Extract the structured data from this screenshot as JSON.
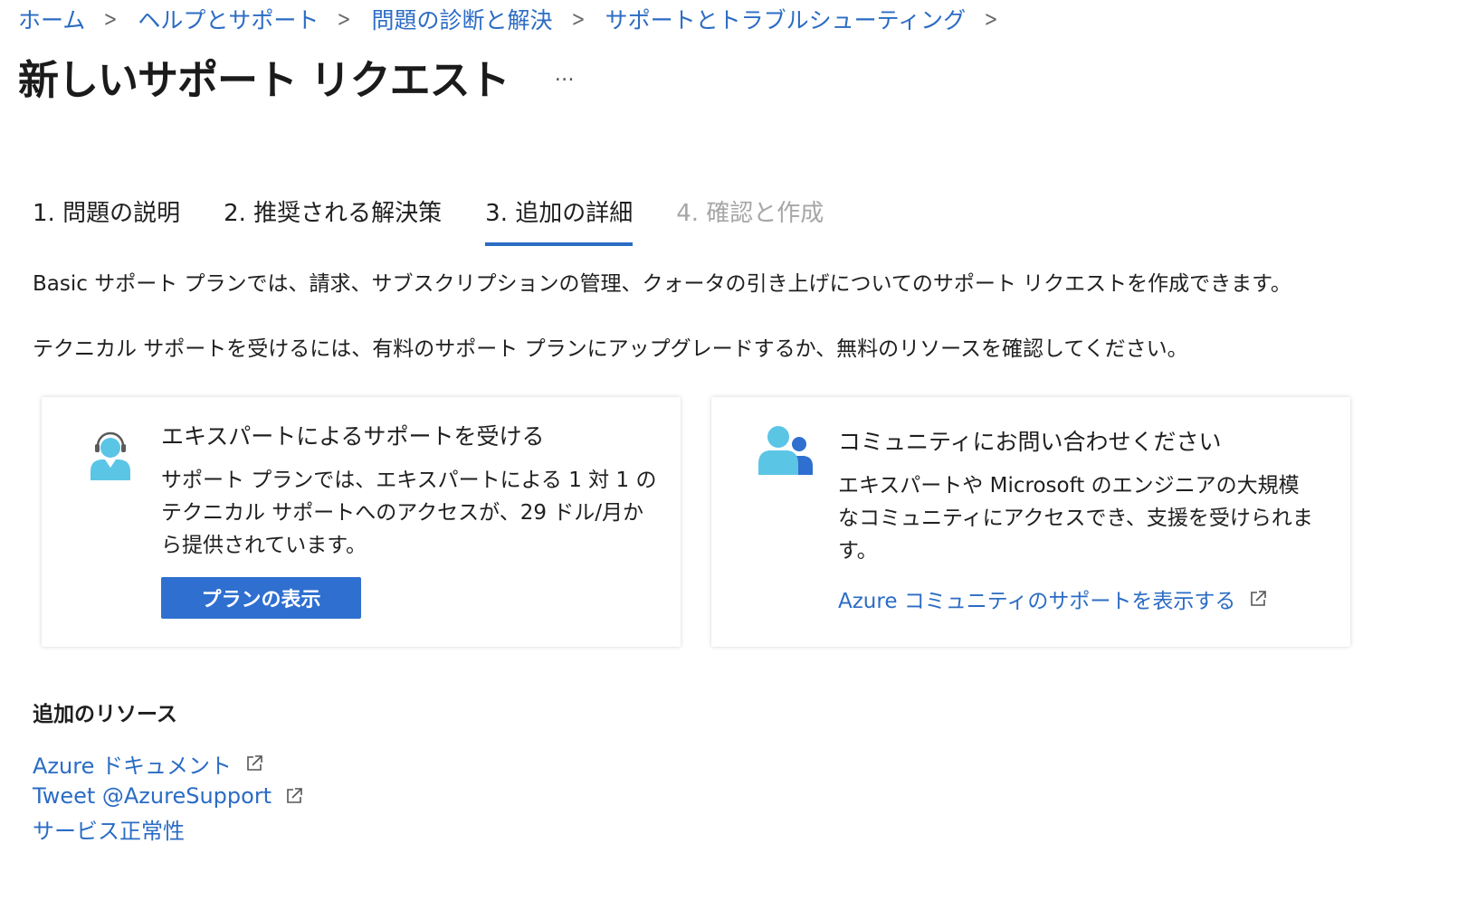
{
  "breadcrumb": [
    {
      "label": "ホーム"
    },
    {
      "label": "ヘルプとサポート"
    },
    {
      "label": "問題の診断と解決"
    },
    {
      "label": "サポートとトラブルシューティング"
    }
  ],
  "page": {
    "title": "新しいサポート リクエスト",
    "more_label": "…"
  },
  "tabs": [
    {
      "label": "1. 問題の説明",
      "state": "complete"
    },
    {
      "label": "2. 推奨される解決策",
      "state": "complete"
    },
    {
      "label": "3. 追加の詳細",
      "state": "active"
    },
    {
      "label": "4. 確認と作成",
      "state": "disabled"
    }
  ],
  "description": {
    "line1": "Basic サポート プランでは、請求、サブスクリプションの管理、クォータの引き上げについてのサポート リクエストを作成できます。",
    "line2": "テクニカル サポートを受けるには、有料のサポート プランにアップグレードするか、無料のリソースを確認してください。"
  },
  "expert_card": {
    "title": "エキスパートによるサポートを受ける",
    "body_lines": [
      "サポート プランでは、エキスパートによる 1 対 1 の",
      "テクニカル サポートへのアクセスが、29 ドル/月か",
      "ら提供されています。"
    ],
    "button_label": "プランの表示",
    "icon": "support-agent-icon"
  },
  "community_card": {
    "title": "コミュニティにお問い合わせください",
    "body_lines": [
      "エキスパートや Microsoft のエンジニアの大規模",
      "なコミュニティにアクセスでき、支援を受けられま",
      "す。"
    ],
    "link_label": "Azure コミュニティのサポートを表示する",
    "icon": "community-users-icon"
  },
  "resources": {
    "heading": "追加のリソース",
    "links": [
      {
        "label": "Azure ドキュメント",
        "external": true
      },
      {
        "label": "Tweet @AzureSupport",
        "external": true
      },
      {
        "label": "サービス正常性",
        "external": false
      }
    ]
  },
  "colors": {
    "link": "#2b6cc4",
    "primary_button": "#2f6fd0",
    "active_tab_underline": "#2b6cc4",
    "disabled_text": "#a6a6a6",
    "icon_cyan": "#5bc5e6",
    "icon_blue": "#2f6fd0"
  }
}
